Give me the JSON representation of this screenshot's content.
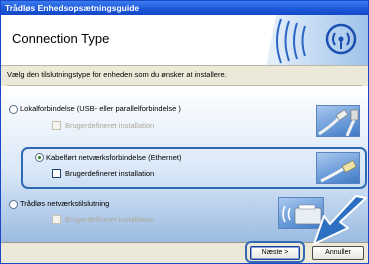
{
  "window": {
    "title": "Trådløs Enhedsopsætningsguide"
  },
  "header": {
    "title": "Connection Type"
  },
  "instruction": "Vælg den tilslutningstype for enheden som du ønsker at installere.",
  "options": [
    {
      "label": "Lokalforbindelse (USB- eller parallelforbindelse )",
      "selected": false,
      "checkbox": {
        "label": "Brugerdefineret installation",
        "enabled": false,
        "checked": false
      },
      "image": "usb-parallel-cable"
    },
    {
      "label": "Kabelført netværksforbindelse (Ethernet)",
      "selected": true,
      "checkbox": {
        "label": "Brugerdefineret installation",
        "enabled": true,
        "checked": false
      },
      "image": "ethernet-cable"
    },
    {
      "label": "Trådløs netværkstilslutning",
      "selected": false,
      "checkbox": {
        "label": "Brugerdefineret installation",
        "enabled": false,
        "checked": false
      },
      "image": "wireless-printer"
    }
  ],
  "buttons": {
    "next": "Næste >",
    "cancel": "Annuller"
  },
  "colors": {
    "titlebar": "#1a56d6",
    "highlight": "#2f69b4",
    "accent": "#1b48c8"
  }
}
